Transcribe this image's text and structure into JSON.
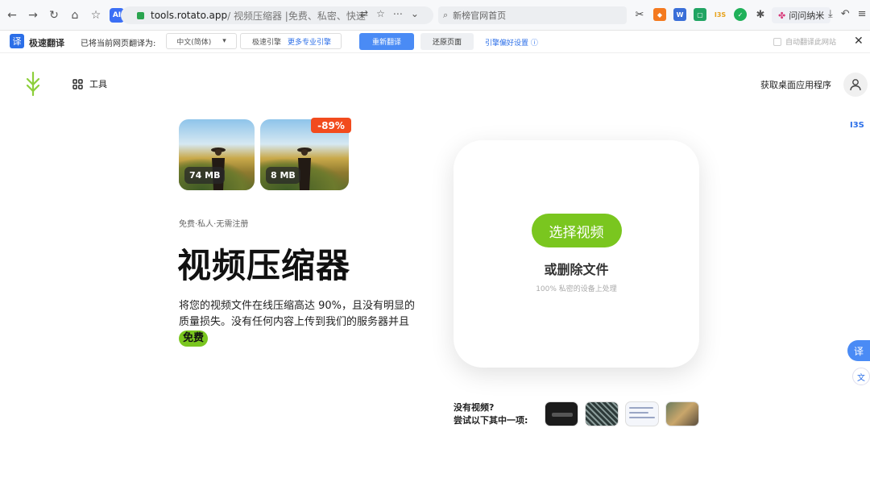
{
  "browser": {
    "url_domain": "tools.rotato.app",
    "url_path": " / 视频压缩器 |免费、私密、快速",
    "search_text": "新榜官网首页",
    "extension_label": "问问纳米",
    "ai_badge": "AI"
  },
  "translator": {
    "logo": "译",
    "name": "极速翻译",
    "prompt": "已将当前网页翻译为:",
    "language": "中文(简体)",
    "engine_label": "极速引擎",
    "more_engines": "更多专业引擎",
    "retranslate": "重新翻译",
    "restore": "还原页面",
    "preferences": "引擎偏好设置",
    "auto_translate": "自动翻译此网站",
    "close": "✕"
  },
  "site": {
    "tools_label": "工具",
    "get_app": "获取桌面应用程序"
  },
  "hero": {
    "before_size": "74 MB",
    "after_size": "8 MB",
    "discount": "-89%",
    "subtitle": "免费·私人·无需注册",
    "title": "视频压缩器",
    "description": "将您的视频文件在线压缩高达 90%，且没有明显的质量损失。没有任何内容上传到我们的服务器并且",
    "free_badge": "免费"
  },
  "uploader": {
    "select_button": "选择视频",
    "drop_text": "或删除文件",
    "privacy_note": "100% 私密的设备上处理"
  },
  "samples": {
    "prompt_line1": "没有视频?",
    "prompt_line2": "尝试以下其中一项:"
  },
  "floating": {
    "side_badge": "I3S",
    "translate_button": "译",
    "wen_button": "文"
  },
  "colors": {
    "accent_green": "#7ac61f",
    "discount_red": "#f24b1e",
    "translator_blue": "#4a8bf5"
  }
}
